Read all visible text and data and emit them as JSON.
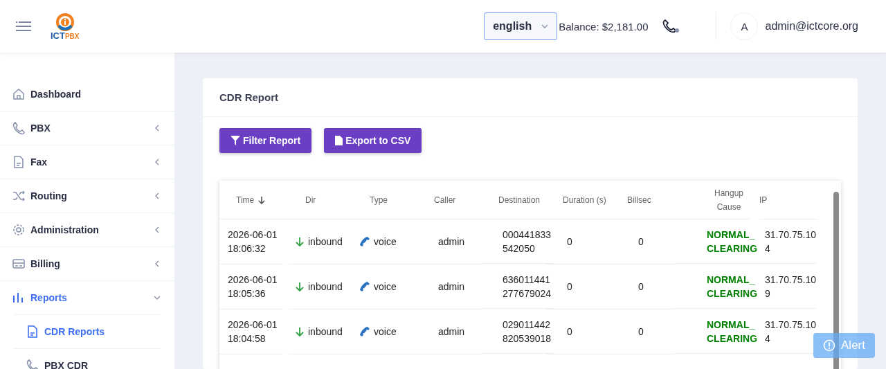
{
  "header": {
    "logo": {
      "part_1": "ICT",
      "part_2": "PBX"
    },
    "language": "english",
    "balance": "Balance: $2,181.00",
    "avatar": "A",
    "user": "admin@ictcore.org"
  },
  "sidebar": {
    "items": [
      {
        "label": "Dashboard",
        "kind": "home",
        "expandable": false,
        "selected": false
      },
      {
        "label": "PBX",
        "kind": "phone",
        "expandable": true,
        "expanded": false,
        "selected": false
      },
      {
        "label": "Fax",
        "kind": "document",
        "expandable": true,
        "expanded": false,
        "selected": false
      },
      {
        "label": "Routing",
        "kind": "shuffle",
        "expandable": true,
        "expanded": false,
        "selected": false
      },
      {
        "label": "Administration",
        "kind": "gear",
        "expandable": true,
        "expanded": false,
        "selected": false
      },
      {
        "label": "Billing",
        "kind": "card",
        "expandable": true,
        "expanded": false,
        "selected": false
      },
      {
        "label": "Reports",
        "kind": "bars",
        "expandable": true,
        "expanded": true,
        "selected": true,
        "children": [
          {
            "label": "CDR Reports",
            "kind": "document",
            "selected": true
          },
          {
            "label": "PBX CDR",
            "kind": "phone",
            "selected": false
          }
        ]
      }
    ]
  },
  "page": {
    "title": "CDR Report",
    "buttons": [
      {
        "label": "Filter Report",
        "kind": "filter"
      },
      {
        "label": "Export to CSV",
        "kind": "file"
      }
    ]
  },
  "table": {
    "columns": [
      {
        "label": "Time",
        "sorted": true
      },
      {
        "label": "Dir",
        "sorted": false
      },
      {
        "label": "Type",
        "sorted": false
      },
      {
        "label": "Caller",
        "sorted": false
      },
      {
        "label": "Destination",
        "sorted": false
      },
      {
        "label": "Duration (s)",
        "sorted": false
      },
      {
        "label": "Billsec",
        "sorted": false
      },
      {
        "label": "Hangup Cause",
        "sorted": false
      },
      {
        "label": "IP",
        "sorted": false
      }
    ],
    "rows": [
      {
        "time": "2026-06-01 18:06:32",
        "dir": {
          "label": "inbound",
          "kind": "in"
        },
        "type": {
          "label": "voice",
          "kind": "voice"
        },
        "caller": "admin",
        "destination": "000441833542050",
        "duration": "0",
        "billsec": "0",
        "hangup_cause": {
          "label": "NORMAL_CLEARING",
          "color": "#008000"
        },
        "ip": "31.70.75.104"
      },
      {
        "time": "2026-06-01 18:05:36",
        "dir": {
          "label": "inbound",
          "kind": "in"
        },
        "type": {
          "label": "voice",
          "kind": "voice"
        },
        "caller": "admin",
        "destination": "636011441277679024",
        "duration": "0",
        "billsec": "0",
        "hangup_cause": {
          "label": "NORMAL_CLEARING",
          "color": "#008000"
        },
        "ip": "31.70.75.109"
      },
      {
        "time": "2026-06-01 18:04:58",
        "dir": {
          "label": "inbound",
          "kind": "in"
        },
        "type": {
          "label": "voice",
          "kind": "voice"
        },
        "caller": "admin",
        "destination": "029011442820539018",
        "duration": "0",
        "billsec": "0",
        "hangup_cause": {
          "label": "NORMAL_CLEARING",
          "color": "#008000"
        },
        "ip": "31.70.75.104"
      }
    ]
  },
  "alert": {
    "label": "Alert"
  }
}
